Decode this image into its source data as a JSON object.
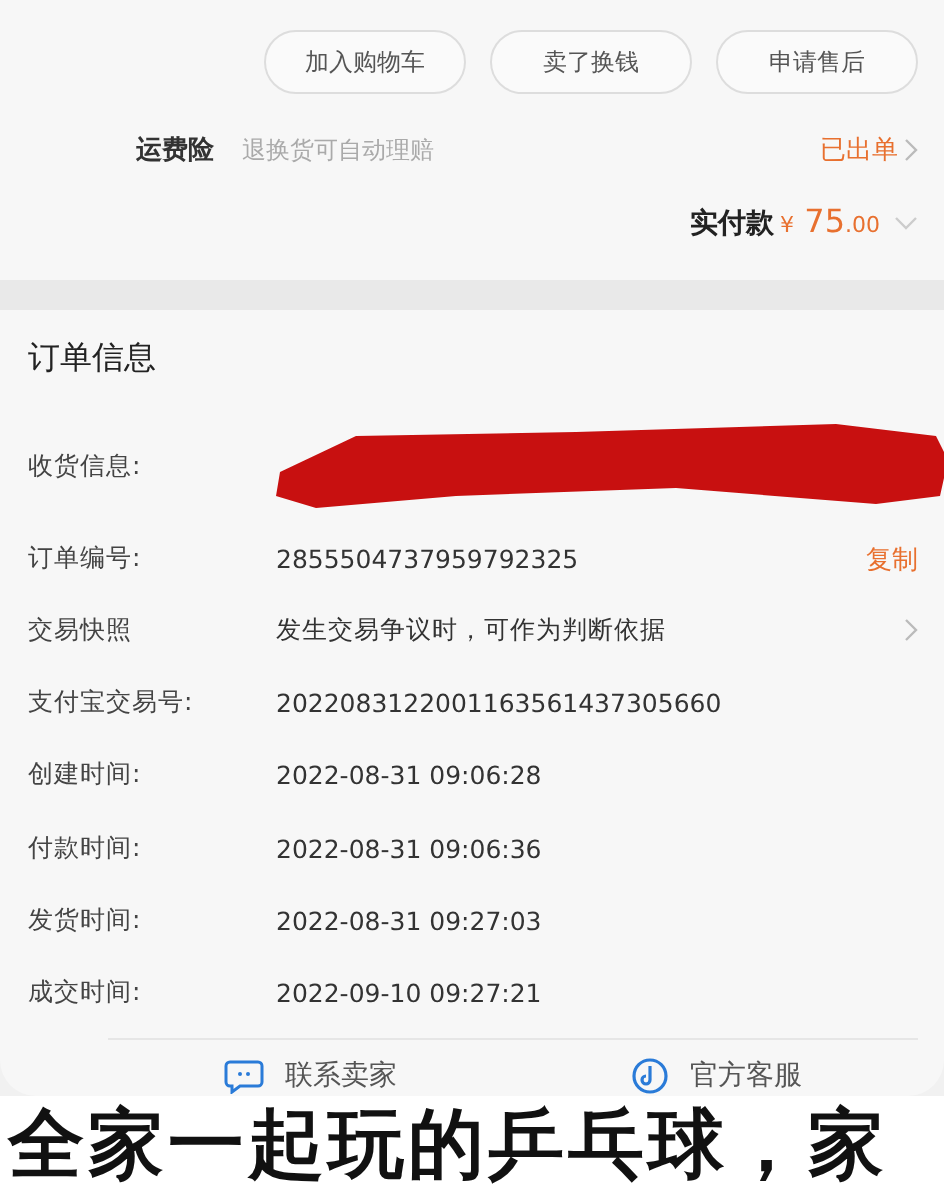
{
  "order_actions": [
    {
      "label": "加入购物车"
    },
    {
      "label": "卖了换钱"
    },
    {
      "label": "申请售后"
    }
  ],
  "insurance": {
    "label": "运费险",
    "description": "退换货可自动理赔",
    "status": "已出单"
  },
  "payment": {
    "label": "实付款",
    "currency": "¥",
    "amount": "75",
    "decimals": ".00"
  },
  "order_info": {
    "title": "订单信息",
    "rows": [
      {
        "kind": "redacted",
        "label": "收货信息:"
      },
      {
        "kind": "copy",
        "label": "订单编号:",
        "value": "2855504737959792325",
        "action": "复制"
      },
      {
        "kind": "link",
        "label": "交易快照",
        "value": "发生交易争议时，可作为判断依据"
      },
      {
        "kind": "plain",
        "label": "支付宝交易号:",
        "value": "2022083122001163561437305660"
      },
      {
        "kind": "plain",
        "label": "创建时间:",
        "value": "2022-08-31 09:06:28"
      },
      {
        "kind": "plain",
        "label": "付款时间:",
        "value": "2022-08-31 09:06:36"
      },
      {
        "kind": "plain",
        "label": "发货时间:",
        "value": "2022-08-31 09:27:03"
      },
      {
        "kind": "plain",
        "label": "成交时间:",
        "value": "2022-09-10 09:27:21"
      }
    ]
  },
  "contact_buttons": [
    {
      "kind": "chat",
      "label": "联系卖家"
    },
    {
      "kind": "service",
      "label": "官方客服"
    }
  ],
  "caption": "全家一起玩的乒乓球，家"
}
